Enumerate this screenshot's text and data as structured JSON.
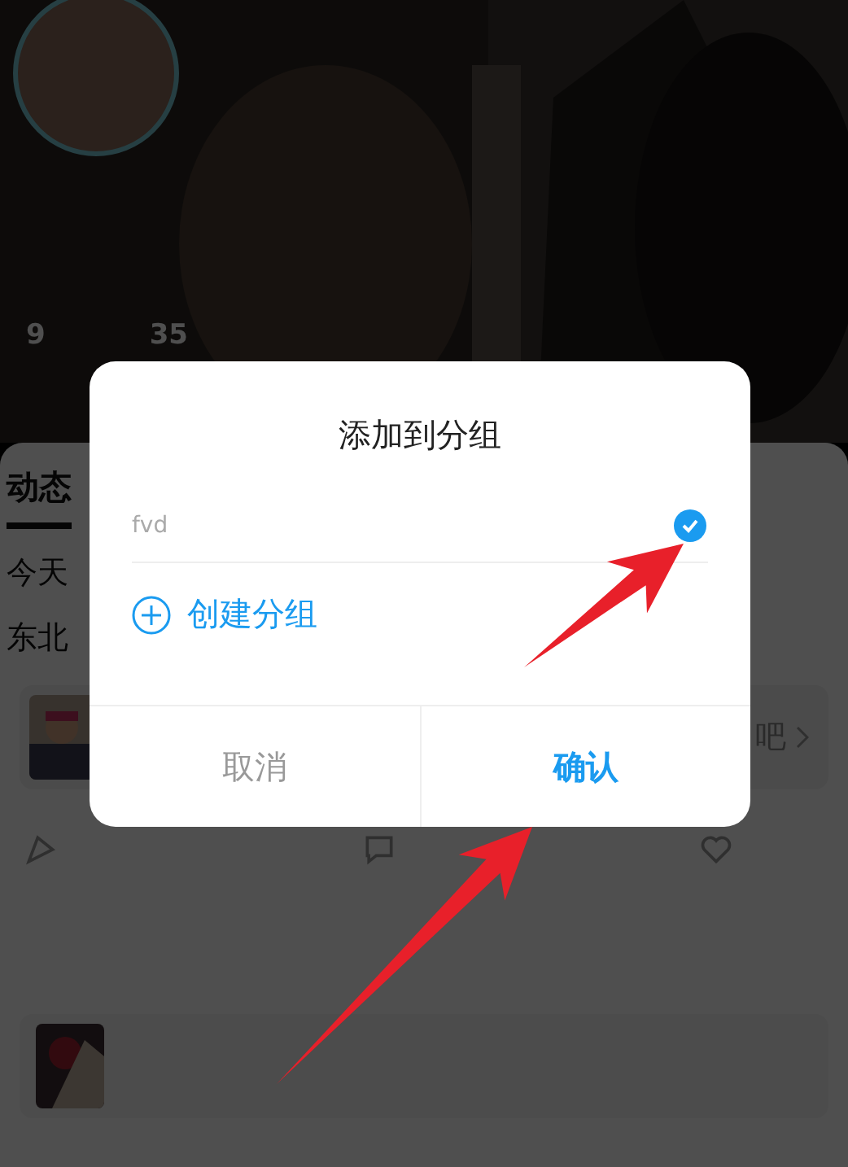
{
  "profile": {
    "stats": [
      {
        "value": "9"
      },
      {
        "value": "35"
      }
    ]
  },
  "tabs": [
    {
      "label": "动态",
      "selected": true
    }
  ],
  "feed": {
    "date": "今天",
    "author": "东北",
    "card_action": "吧"
  },
  "dialog": {
    "title": "添加到分组",
    "groups": [
      {
        "name": "fvd",
        "selected": true
      }
    ],
    "create_label": "创建分组",
    "buttons": [
      {
        "label": "取消",
        "kind": "cancel"
      },
      {
        "label": "确认",
        "kind": "confirm"
      }
    ]
  }
}
